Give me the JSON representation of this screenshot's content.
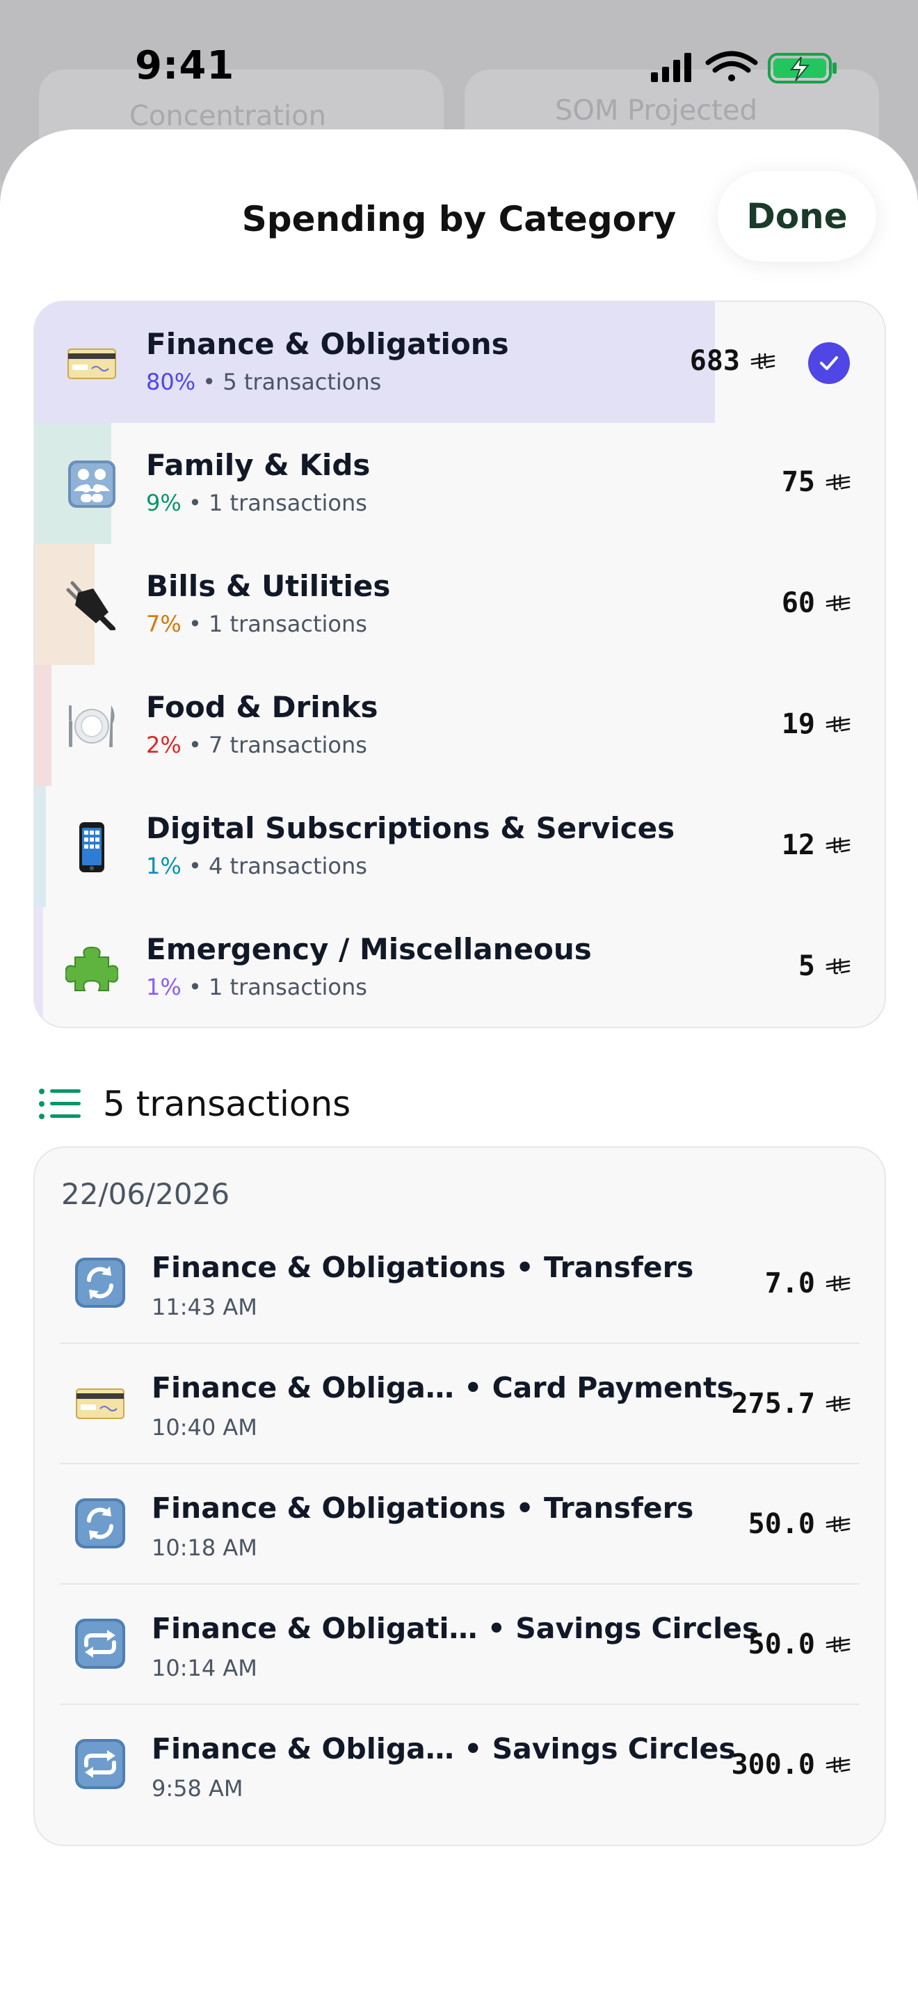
{
  "status_bar": {
    "time": "9:41"
  },
  "background_app": {
    "left_card_label": "Concentration",
    "right_card_label": "SOM Projected"
  },
  "sheet": {
    "title": "Spending by Category",
    "done_label": "Done"
  },
  "currency_icon": "saudi-riyal-icon",
  "categories": [
    {
      "name": "Finance & Obligations",
      "percent": "80%",
      "transactions": "5 transactions",
      "amount": "683",
      "icon": "credit-card-icon",
      "color": "#4f46e5",
      "bar_fill": 0.8,
      "selected": true
    },
    {
      "name": "Family & Kids",
      "percent": "9%",
      "transactions": "1 transactions",
      "amount": "75",
      "icon": "family-icon",
      "color": "#059669",
      "bar_fill": 0.09,
      "selected": false
    },
    {
      "name": "Bills & Utilities",
      "percent": "7%",
      "transactions": "1 transactions",
      "amount": "60",
      "icon": "plug-icon",
      "color": "#d97706",
      "bar_fill": 0.07,
      "selected": false
    },
    {
      "name": "Food & Drinks",
      "percent": "2%",
      "transactions": "7 transactions",
      "amount": "19",
      "icon": "plate-cutlery-icon",
      "color": "#dc2626",
      "bar_fill": 0.02,
      "selected": false
    },
    {
      "name": "Digital Subscriptions & Services",
      "percent": "1%",
      "transactions": "4 transactions",
      "amount": "12",
      "icon": "phone-icon",
      "color": "#0891b2",
      "bar_fill": 0.01,
      "selected": false
    },
    {
      "name": "Emergency / Miscellaneous",
      "percent": "1%",
      "transactions": "1 transactions",
      "amount": "5",
      "icon": "puzzle-icon",
      "color": "#8b5cf6",
      "bar_fill": 0.01,
      "selected": false
    }
  ],
  "transactions": {
    "header": "5 transactions",
    "date": "22/06/2026",
    "items": [
      {
        "name": "Finance & Obligations • Transfers",
        "time": "11:43 AM",
        "amount": "7.0",
        "icon": "refresh-icon"
      },
      {
        "name": "Finance & Obliga… • Card Payments",
        "time": "10:40 AM",
        "amount": "275.7",
        "icon": "credit-card-icon"
      },
      {
        "name": "Finance & Obligations • Transfers",
        "time": "10:18 AM",
        "amount": "50.0",
        "icon": "refresh-icon"
      },
      {
        "name": "Finance & Obligati… • Savings Circles",
        "time": "10:14 AM",
        "amount": "50.0",
        "icon": "repeat-icon"
      },
      {
        "name": "Finance & Obliga… • Savings Circles",
        "time": "9:58 AM",
        "amount": "300.0",
        "icon": "repeat-icon"
      }
    ]
  }
}
